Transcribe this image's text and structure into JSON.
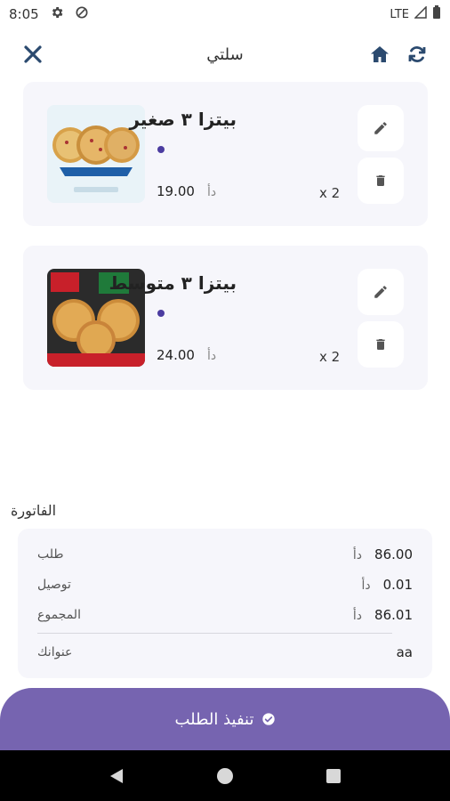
{
  "status_bar": {
    "time": "8:05",
    "network": "LTE"
  },
  "header": {
    "title": "سلتي"
  },
  "cart": {
    "items": [
      {
        "name": "بيتزا ٣ صغير",
        "price": "19.00",
        "currency": "دأ",
        "quantity": "x 2"
      },
      {
        "name": "بيتزا ٣ متوسط",
        "price": "24.00",
        "currency": "دأ",
        "quantity": "x 2"
      }
    ]
  },
  "invoice": {
    "title": "الفاتورة",
    "rows": [
      {
        "label": "طلب",
        "value": "86.00",
        "currency": "دأ"
      },
      {
        "label": "توصيل",
        "value": "0.01",
        "currency": "دأ"
      },
      {
        "label": "المجموع",
        "value": "86.01",
        "currency": "دأ"
      },
      {
        "label": "عنوانك",
        "value": "aa",
        "currency": ""
      }
    ]
  },
  "checkout": {
    "label": "تنفيذ الطلب"
  },
  "colors": {
    "accent": "#7664b0",
    "card_bg": "#f6f6fb",
    "dot": "#4b3ca0"
  }
}
